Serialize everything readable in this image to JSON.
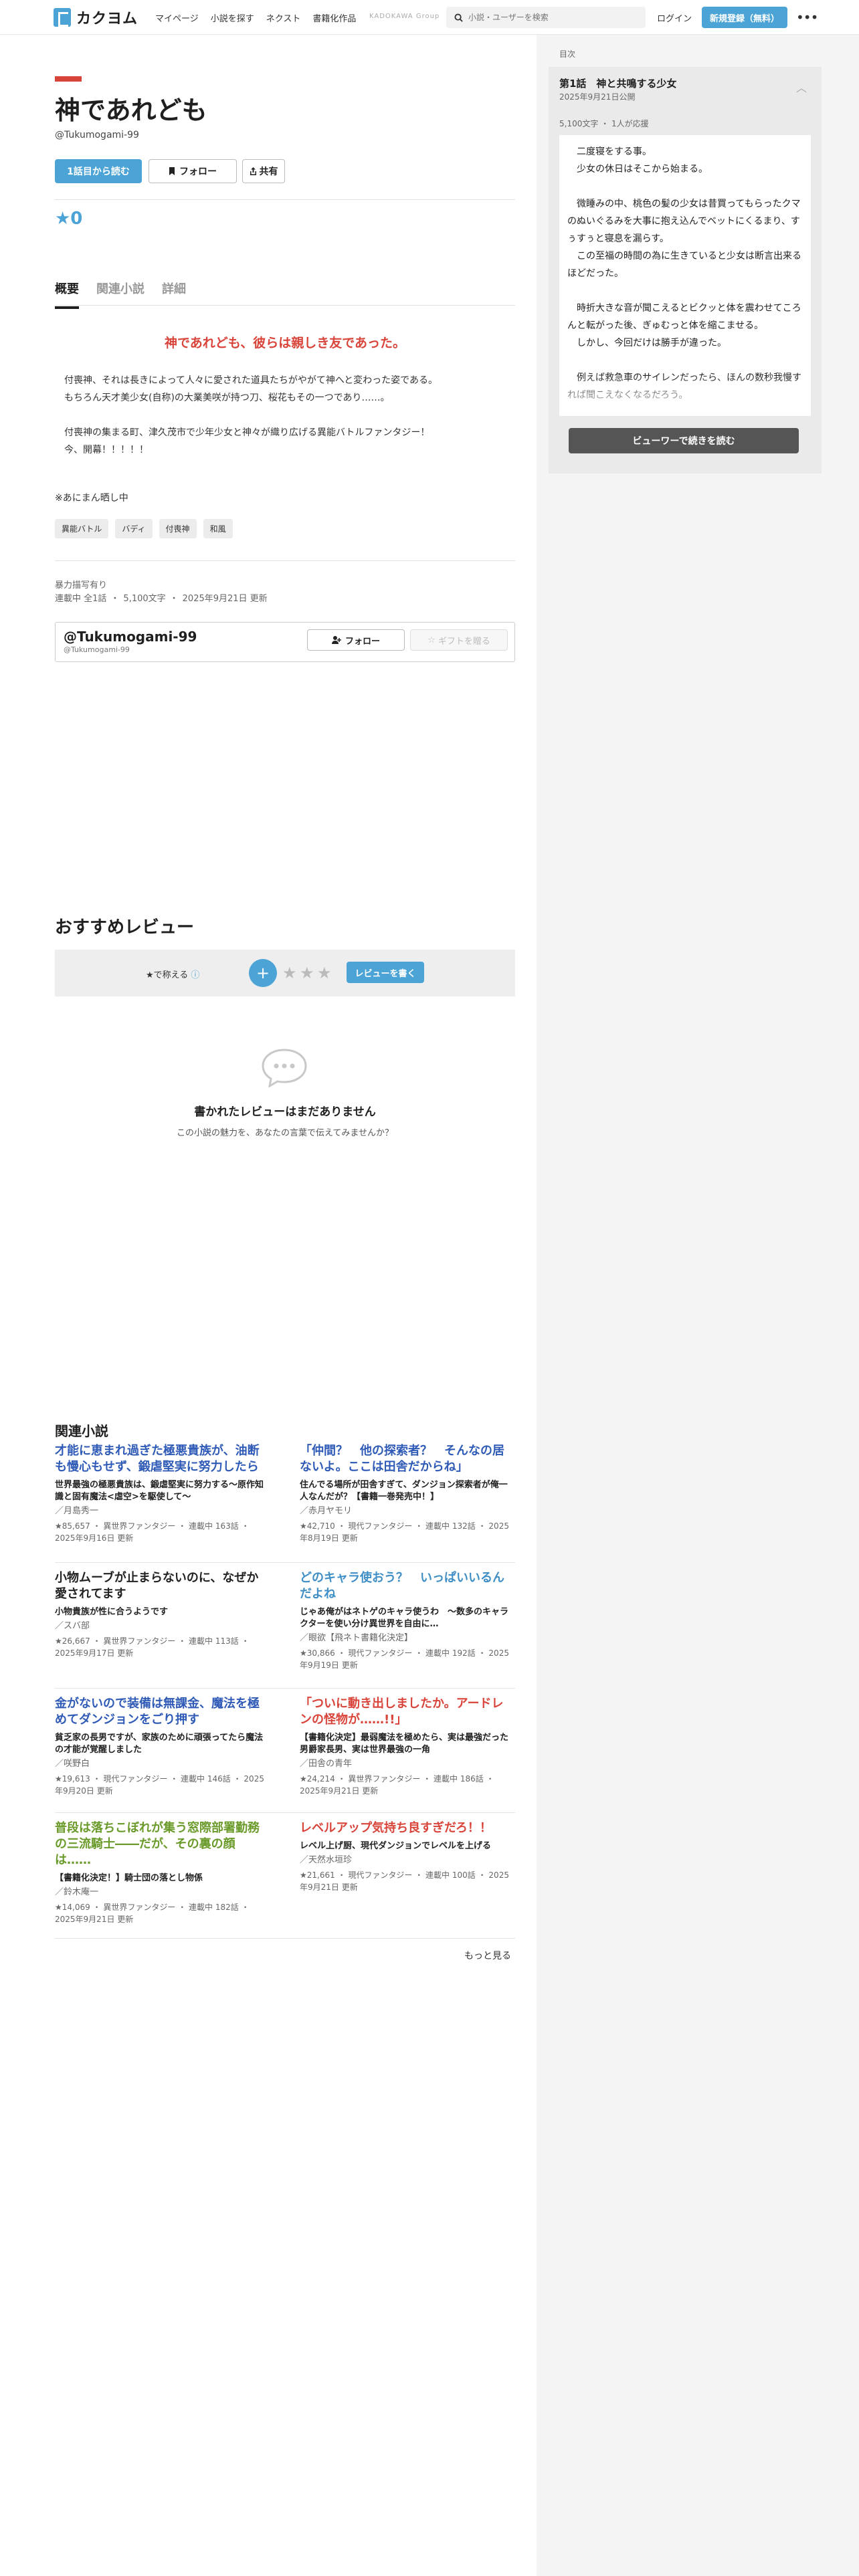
{
  "header": {
    "logo": "カクヨム",
    "nav": [
      "マイページ",
      "小説を探す",
      "ネクスト",
      "書籍化作品"
    ],
    "kadokawa": "KADOKAWA Group",
    "search_placeholder": "小説・ユーザーを検索",
    "login": "ログイン",
    "signup": "新規登録（無料）"
  },
  "work": {
    "title": "神であれども",
    "author_handle": "@Tukumogami-99",
    "read_first": "1話目から読む",
    "follow": "フォロー",
    "share": "共有",
    "star_total": "★0"
  },
  "tabs": [
    "概要",
    "関連小説",
    "詳細"
  ],
  "summary": {
    "catch": "神であれども、彼らは親しき友であった。",
    "intro": "付喪神、それは長きによって人々に愛された道具たちがやがて神へと変わった姿である。\nもちろん天才美少女(自称)の大業美咲が持つ刀、桜花もその一つであり……。\n\n付喪神の集まる町、津久茂市で少年少女と神々が織り広げる異能バトルファンタジー！\n今、開幕！！！！！",
    "note": "※あにまん晒し中",
    "tags": [
      "異能バトル",
      "バディ",
      "付喪神",
      "和風"
    ],
    "warning": "暴力描写有り",
    "meta": [
      "連載中 全1話",
      "5,100文字",
      "2025年9月21日 更新"
    ]
  },
  "author_card": {
    "name": "@Tukumogami-99",
    "handle": "@Tukumogami-99",
    "follow": "フォロー",
    "gift": "ギフトを贈る"
  },
  "reviews": {
    "heading": "おすすめレビュー",
    "praise_label": "★で称える",
    "write_button": "レビューを書く",
    "empty_title": "書かれたレビューはまだありません",
    "empty_sub": "この小説の魅力を、あなたの言葉で伝えてみませんか？"
  },
  "related": {
    "heading": "関連小説",
    "more": "もっと見る",
    "items": [
      {
        "title": "才能に恵まれ過ぎた極悪貴族が、油断も慢心もせず、鍛虐堅実に努力したら",
        "color": "#2f5bb7",
        "desc": "世界最強の極悪貴族は、鍛虐堅実に努力する〜原作知識と固有魔法<虐空>を駆使して〜",
        "author": "／月島秀一",
        "stars": "★85,657",
        "genre": "異世界ファンタジー",
        "status": "連載中 163話",
        "updated": "2025年9月16日 更新"
      },
      {
        "title": "「仲間？　他の探索者？　そんなの居ないよ。ここは田舎だからね」",
        "color": "#2f5bb7",
        "desc": "住んでる場所が田舎すぎて、ダンジョン探索者が俺一人なんだが？【書籍一巻発売中！】",
        "author": "／赤月ヤモリ",
        "stars": "★42,710",
        "genre": "現代ファンタジー",
        "status": "連載中 132話",
        "updated": "2025年8月19日 更新"
      },
      {
        "title": "小物ムーブが止まらないのに、なぜか愛されてます",
        "color": "#222222",
        "desc": "小物貴族が性に合うようです",
        "author": "／スバ部",
        "stars": "★26,667",
        "genre": "異世界ファンタジー",
        "status": "連載中 113話",
        "updated": "2025年9月17日 更新"
      },
      {
        "title": "どのキャラ使おう？　いっぱいいるんだよね",
        "color": "#3f8fc6",
        "desc": "じゃあ俺がはネトゲのキャラ使うわ　〜数多のキャラクターを使い分け異世界を自由に…",
        "author": "／眼欲【飛ネト書籍化決定】",
        "stars": "★30,866",
        "genre": "現代ファンタジー",
        "status": "連載中 192話",
        "updated": "2025年9月19日 更新"
      },
      {
        "title": "金がないので装備は無課金、魔法を極めてダンジョンをごり押す",
        "color": "#2f5bb7",
        "desc": "貧乏家の長男ですが、家族のために頑張ってたら魔法の才能が覚醒しました",
        "author": "／咲野白",
        "stars": "★19,613",
        "genre": "現代ファンタジー",
        "status": "連載中 146話",
        "updated": "2025年9月20日 更新"
      },
      {
        "title": "「ついに動き出しましたか。アードレンの怪物が……!!」",
        "color": "#d9443a",
        "desc": "【書籍化決定】最弱魔法を極めたら、実は最強だった男爵家長男、実は世界最強の一角",
        "author": "／田舎の青年",
        "stars": "★24,214",
        "genre": "異世界ファンタジー",
        "status": "連載中 186話",
        "updated": "2025年9月21日 更新"
      },
      {
        "title": "普段は落ちこぼれが集う窓際部署勤務の三流騎士――だが、その裏の顔は……",
        "color": "#6a9a2a",
        "desc": "【書籍化決定！】騎士団の落とし物係",
        "author": "／鈴木庵一",
        "stars": "★14,069",
        "genre": "異世界ファンタジー",
        "status": "連載中 182話",
        "updated": "2025年9月21日 更新"
      },
      {
        "title": "レベルアップ気持ち良すぎだろ！！",
        "color": "#d9443a",
        "desc": "レベル上げ厨、現代ダンジョンでレベルを上げる",
        "author": "／天然水垣珍",
        "stars": "★21,661",
        "genre": "現代ファンタジー",
        "status": "連載中 100話",
        "updated": "2025年9月21日 更新"
      }
    ]
  },
  "sidebar": {
    "toc_label": "目次",
    "episode_title": "第1話　神と共鳴する少女",
    "episode_date": "2025年9月21日公開",
    "episode_meta": "5,100文字 ・ 1人が応援",
    "episode_text": "　二度寝をする事。\n　少女の休日はそこから始まる。\n\n　微睡みの中、桃色の髪の少女は昔買ってもらったクマのぬいぐるみを大事に抱え込んでベットにくるまり、すぅすぅと寝息を漏らす。\n　この至福の時間の為に生きていると少女は断言出来るほどだった。\n\n　時折大きな音が聞こえるとビクッと体を震わせてころんと転がった後、ぎゅむっと体を縮こませる。\n　しかし、今回だけは勝手が違った。\n\n　例えば救急車のサイレンだったら、ほんの数秒我慢すれば聞こえなくなるだろう。",
    "viewer_button": "ビューワーで続きを読む"
  }
}
